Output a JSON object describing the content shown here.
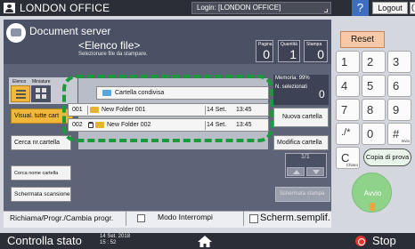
{
  "topbar": {
    "office_name": "LONDON OFFICE",
    "login_text": "Login: [LONDON OFFICE]",
    "help_label": "?",
    "logout_label": "Logout",
    "partial_label": "("
  },
  "panel": {
    "title": "Document server",
    "file_list_title": "<Elenco file>",
    "file_list_subtitle": "Selezionare file da stampare.",
    "counters": [
      {
        "label": "Pagina",
        "value": "0"
      },
      {
        "label": "Quantità",
        "value": "1"
      },
      {
        "label": "Stampa",
        "value": "0"
      }
    ]
  },
  "view": {
    "elenco_label": "Elenco",
    "miniature_label": "Miniature",
    "active": "list"
  },
  "left_buttons": {
    "show_all": "Visual. tutte cart",
    "search_folder": "Cerca nr.cartella",
    "search_folder_name": "Cerca nome cartella",
    "scan_screen": "Schermata scansione"
  },
  "file_list": {
    "shared_folder": "Cartella condivisa",
    "rows": [
      {
        "number": "001",
        "locked": false,
        "name": "New Folder 001",
        "date": "14 Set.",
        "time": "13:45"
      },
      {
        "number": "002",
        "locked": true,
        "name": "New Folder 002",
        "date": "14 Set.",
        "time": "13:45"
      }
    ]
  },
  "right": {
    "memory_label": "Memoria: 99%",
    "selected_label": "N. selezionati",
    "selected_count": "0",
    "new_folder": "Nuova cartella",
    "modify_folder": "Modifica cartella",
    "page_indicator": "1/1",
    "print_screen": "Schermata stampa"
  },
  "footer": {
    "recall_program": "Richiama/Progr./Cambia progr.",
    "interrupt_mode": "Modo Interrompi",
    "simplified_screen": "Scherm.semplif."
  },
  "keypad": {
    "reset": "Reset",
    "keys": [
      "1",
      "2",
      "3",
      "4",
      "5",
      "6",
      "7",
      "8",
      "9",
      "./*",
      "0",
      "#"
    ],
    "hash_sub": "Invio",
    "clear": "C",
    "clear_sub": "Chiaro",
    "copy_proof": "Copia di prova",
    "start": "Avvio"
  },
  "bottombar": {
    "status_check": "Controlla stato",
    "date": "14 Set. 2018",
    "time": "15 : 52",
    "stop": "Stop"
  },
  "colors": {
    "topbar": "#2b2e36",
    "panel": "#5d6478",
    "accent_orange": "#f1b73a",
    "highlight_green": "#1a9a3a",
    "start_green": "#8fd38b",
    "stop_red": "#e4362f"
  },
  "icons": [
    "user-icon",
    "server-icon",
    "folder-icon",
    "lock-icon",
    "home-icon",
    "stop-icon",
    "arrow-up-icon",
    "arrow-down-icon"
  ]
}
